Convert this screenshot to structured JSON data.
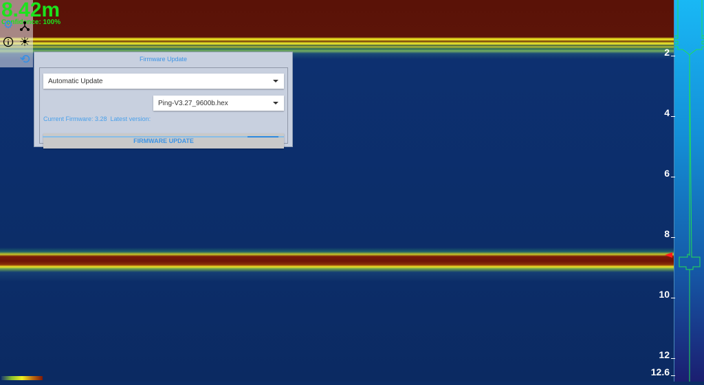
{
  "readout": {
    "depth": "8.42m",
    "confidence": "Confidence: 100%"
  },
  "icons": [
    "settings-icon",
    "network-icon",
    "info-icon",
    "brightness-icon",
    "firmware-update-icon"
  ],
  "depth_scale": {
    "ticks": [
      "2",
      "4",
      "6",
      "8",
      "10",
      "12",
      "12.6"
    ],
    "max_depth": 12.6,
    "current_depth": 8.42
  },
  "dialog": {
    "title": "Firmware Update",
    "mode_select": "Automatic Update",
    "current_firmware": "Current Firmware: 3.28",
    "latest_version": "Latest version:",
    "file_select": "Ping-V3.27_9600b.hex",
    "update_button": "FIRMWARE UPDATE"
  },
  "colors": {
    "depth_text": "#1de21d",
    "accent": "#3b93e6",
    "marker": "#ff1a1a"
  }
}
